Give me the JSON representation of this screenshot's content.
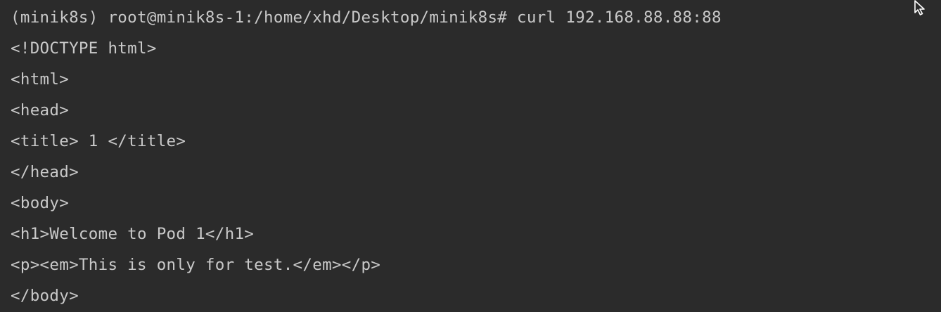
{
  "terminal": {
    "prompt": "(minik8s) root@minik8s-1:/home/xhd/Desktop/minik8s#",
    "command": "curl 192.168.88.88:88",
    "output": [
      "<!DOCTYPE html>",
      "<html>",
      "<head>",
      "<title> 1 </title>",
      "</head>",
      "<body>",
      "<h1>Welcome to Pod 1</h1>",
      "<p><em>This is only for test.</em></p>",
      "</body>"
    ]
  },
  "icons": {
    "cursor": "mouse-pointer-icon"
  },
  "colors": {
    "background": "#2b2b2b",
    "text": "#c9c9c9"
  }
}
